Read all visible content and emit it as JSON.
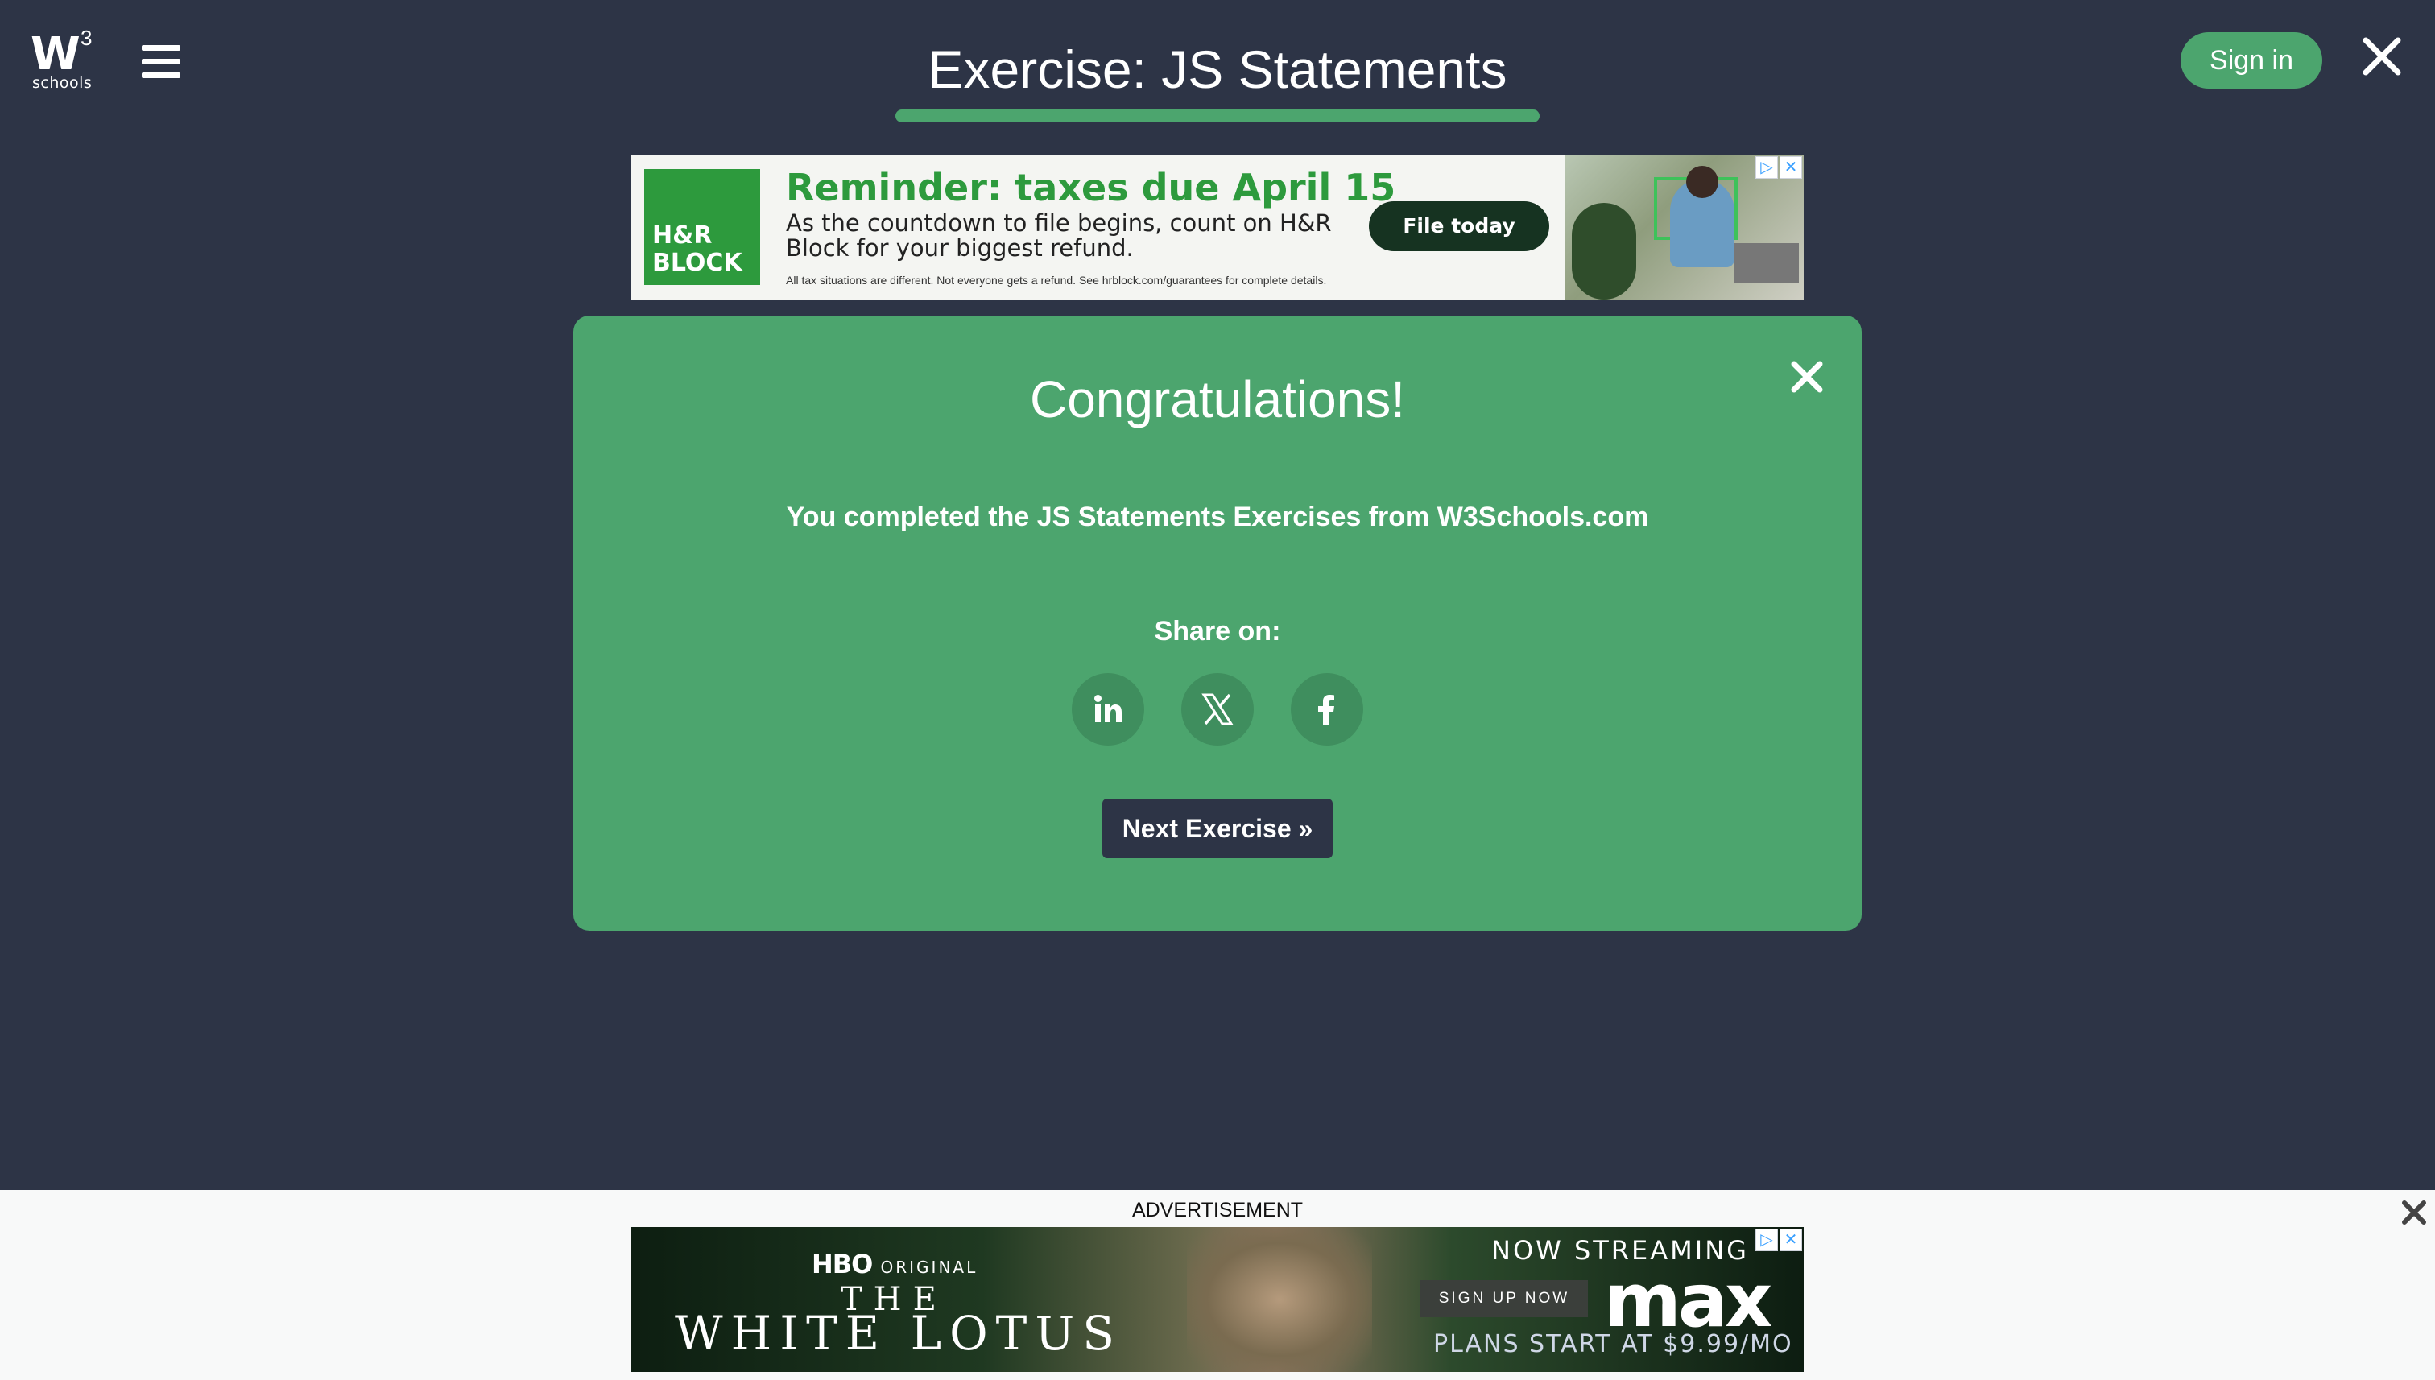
{
  "header": {
    "logo_text": "W",
    "logo_superscript": "3",
    "logo_subtext": "schools",
    "title": "Exercise: JS Statements",
    "signin_label": "Sign in",
    "icons": {
      "menu": "hamburger-menu-icon",
      "close": "close-icon"
    }
  },
  "top_ad": {
    "brand": "H&R BLOCK",
    "headline": "Reminder: taxes due April 15",
    "subtext": "As the countdown to file begins, count on H&R Block for your biggest refund.",
    "fine_print": "All tax situations are different. Not everyone gets a refund. See hrblock.com/guarantees for complete details.",
    "cta": "File today",
    "ad_choices_icon": "ad-choices-icon"
  },
  "modal": {
    "heading": "Congratulations!",
    "message": "You completed the JS Statements Exercises from W3Schools.com",
    "share_label": "Share on:",
    "share_icons": [
      "linkedin-icon",
      "x-icon",
      "facebook-icon"
    ],
    "next_label": "Next Exercise »"
  },
  "bottom_ad": {
    "label": "ADVERTISEMENT",
    "hbo": "HBO",
    "hbo_original": "ORIGINAL",
    "show_the": "THE",
    "show_name": "WHITE LOTUS",
    "now_streaming": "NOW STREAMING",
    "signup": "SIGN UP NOW",
    "service": "max",
    "plans": "PLANS START AT $9.99/MO"
  },
  "colors": {
    "background": "#2d3446",
    "accent_green": "#4ca56e",
    "share_button": "#3f8e5e",
    "brand_green": "#2d9a3d"
  }
}
